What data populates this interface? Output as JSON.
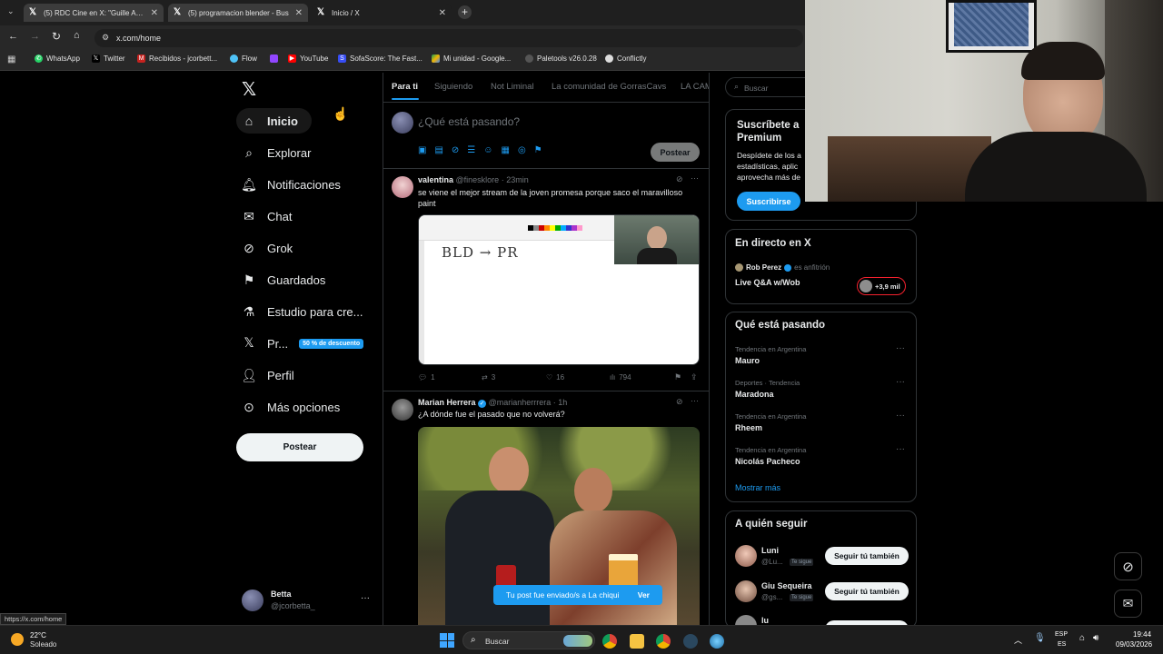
{
  "browser": {
    "tabs": [
      {
        "label": "(5) RDC Cine en X: \"Guille Aqui",
        "active": false
      },
      {
        "label": "(5) programacion blender - Bus",
        "active": false
      },
      {
        "label": "Inicio / X",
        "active": true
      }
    ],
    "url": "x.com/home",
    "bookmarks": [
      "WhatsApp",
      "Twitter",
      "Recibidos - jcorbett...",
      "Flow",
      "YouTube",
      "SofaScore: The Fast...",
      "Mi unidad - Google...",
      "Paletools v26.0.28",
      "Conflictly"
    ],
    "status_url": "https://x.com/home"
  },
  "nav": {
    "logo": "X",
    "items": [
      {
        "label": "Inicio",
        "icon": "home-icon"
      },
      {
        "label": "Explorar",
        "icon": "search-icon"
      },
      {
        "label": "Notificaciones",
        "icon": "bell-icon"
      },
      {
        "label": "Chat",
        "icon": "mail-icon"
      },
      {
        "label": "Grok",
        "icon": "grok-icon"
      },
      {
        "label": "Guardados",
        "icon": "bookmark-icon"
      },
      {
        "label": "Estudio para cre...",
        "icon": "flask-icon"
      },
      {
        "label": "Pr...",
        "icon": "x-icon"
      },
      {
        "label": "Perfil",
        "icon": "person-icon"
      },
      {
        "label": "Más opciones",
        "icon": "more-circle-icon"
      }
    ],
    "premium_badge": "50 % de descuento",
    "post_button": "Postear",
    "account": {
      "name": "Betta",
      "handle": "@jcorbetta_",
      "more": "···"
    }
  },
  "feed": {
    "tabs": [
      "Para ti",
      "Siguiendo",
      "Not Liminal",
      "La comunidad de GorrasCavs",
      "LA CAM"
    ],
    "compose": {
      "placeholder": "¿Qué está pasando?",
      "post_button": "Postear"
    },
    "posts": [
      {
        "author": "valentina",
        "handle": "@finesklore",
        "time": "23min",
        "text": "se viene el mejor stream de la joven promesa porque saco el maravilloso paint",
        "image_text": "BLD → PR",
        "replies": "1",
        "reposts": "3",
        "likes": "16",
        "views": "794"
      },
      {
        "author": "Marian Herrera",
        "handle": "@marianherrrera",
        "time": "1h",
        "text": "¿A dónde fue el pasado que no volverá?"
      }
    ],
    "toast": {
      "text": "Tu post fue enviado/s a La chiqui",
      "action": "Ver"
    }
  },
  "sidebar": {
    "search_placeholder": "Buscar",
    "premium": {
      "title": "Suscríbete a Premium",
      "text": "Despídete de los a estadísticas, aplic aprovecha más de",
      "button": "Suscribirse"
    },
    "live": {
      "title": "En directo en X",
      "host": "Rob Perez",
      "host_role": "es anfitrión",
      "event": "Live Q&A w/Wob",
      "listeners": "+3,9 mil"
    },
    "trends": {
      "title": "Qué está pasando",
      "items": [
        {
          "category": "Tendencia en Argentina",
          "name": "Mauro"
        },
        {
          "category": "Deportes · Tendencia",
          "name": "Maradona"
        },
        {
          "category": "Tendencia en Argentina",
          "name": "Rheem"
        },
        {
          "category": "Tendencia en Argentina",
          "name": "Nicolás Pacheco"
        }
      ],
      "show_more": "Mostrar más"
    },
    "follow": {
      "title": "A quién seguir",
      "items": [
        {
          "name": "Luni",
          "handle": "@Lu...",
          "badge": "Te sigue",
          "button": "Seguir tú también"
        },
        {
          "name": "Giu Sequeira",
          "handle": "@gs...",
          "badge": "Te sigue",
          "button": "Seguir tú también"
        },
        {
          "name": "lu",
          "handle": "",
          "badge": "",
          "button": "Seguir tú también"
        }
      ]
    }
  },
  "taskbar": {
    "weather_temp": "22°C",
    "weather_text": "Soleado",
    "search_placeholder": "Buscar",
    "lang_top": "ESP",
    "lang_bottom": "ES",
    "time": "19:44",
    "date": "09/03/2026"
  },
  "colors": {
    "accent": "#1d9bf0",
    "bg": "#000000",
    "border": "#2f3336",
    "muted": "#71767b",
    "premium_badge": "#1d9bf0"
  }
}
